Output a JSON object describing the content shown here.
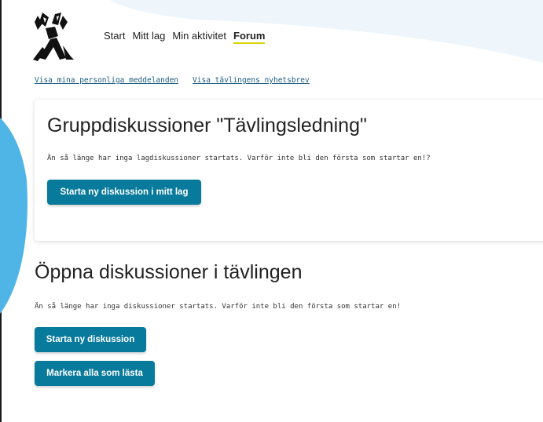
{
  "nav": {
    "items": [
      {
        "label": "Start",
        "active": false
      },
      {
        "label": "Mitt lag",
        "active": false
      },
      {
        "label": "Min aktivitet",
        "active": false
      },
      {
        "label": "Forum",
        "active": true
      }
    ]
  },
  "links": {
    "messages": "Visa mina personliga meddelanden",
    "newsletter": "Visa tävlingens nyhetsbrev"
  },
  "group": {
    "title": "Gruppdiskussioner \"Tävlingsledning\"",
    "empty_text": "Än så länge har inga lagdiskussioner startats. Varför inte bli den första som startar en!?",
    "start_button": "Starta ny diskussion i mitt lag"
  },
  "open": {
    "title": "Öppna diskussioner i tävlingen",
    "empty_text": "Än så länge har inga diskussioner startats. Varför inte bli den första som startar en!",
    "start_button": "Starta ny diskussion",
    "mark_button": "Markera alla som lästa"
  },
  "colors": {
    "primary_button": "#087a9c",
    "link": "#1b5c80",
    "accent_underline": "#d7d300",
    "decor_blue": "#4fb4e6"
  }
}
